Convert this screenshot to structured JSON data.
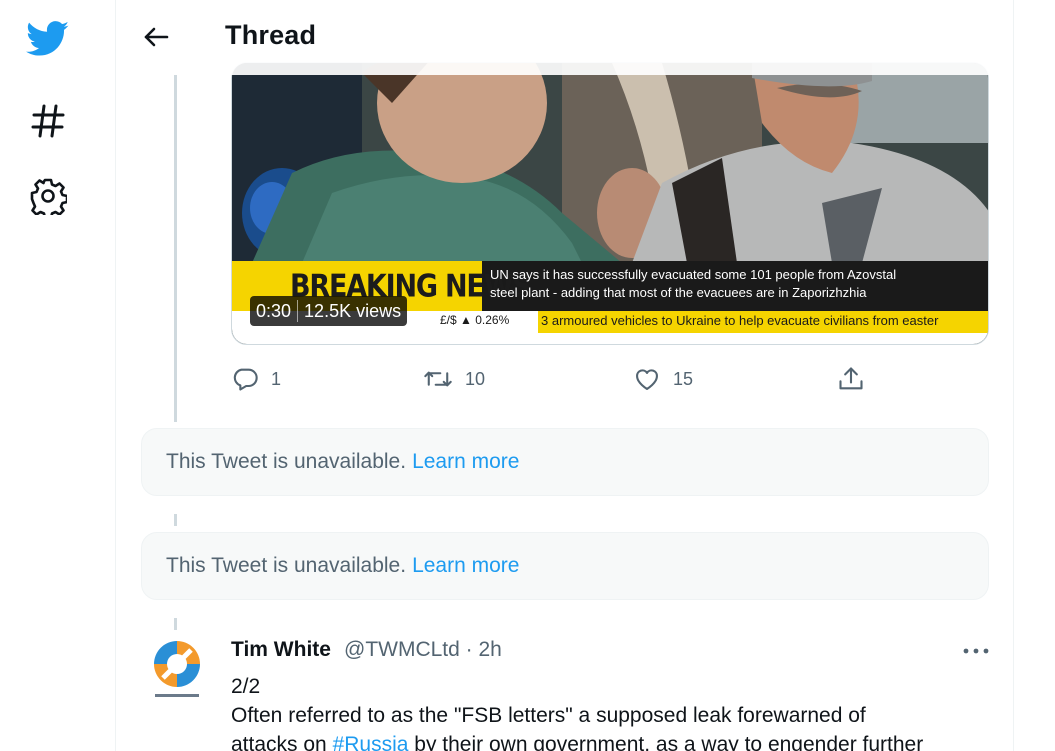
{
  "header": {
    "title": "Thread"
  },
  "nav": {
    "logo_icon": "twitter-bird-icon",
    "explore_icon": "hashtag-icon",
    "settings_icon": "gear-icon"
  },
  "video": {
    "breaking_label": "BREAKING NEWS",
    "caption_line1": "UN says it has successfully evacuated some 101 people from Azovstal",
    "caption_line2": "steel plant - adding that most of the evacuees are in Zaporizhzhia",
    "ticker_rate": "£/$ ▲ 0.26%",
    "ticker_text": "3 armoured vehicles to Ukraine to help evacuate civilians from easter",
    "duration": "0:30",
    "views": "12.5K views"
  },
  "actions": {
    "replies": "1",
    "retweets": "10",
    "likes": "15"
  },
  "unavailable": [
    {
      "text": "This Tweet is unavailable.",
      "link": "Learn more"
    },
    {
      "text": "This Tweet is unavailable.",
      "link": "Learn more"
    }
  ],
  "tweet": {
    "name": "Tim White",
    "handle": "@TWMCLtd",
    "time": "· 2h",
    "line1": "2/2",
    "line2": "Often referred to as the \"FSB letters\" a supposed leak forewarned of",
    "line3_prefix": "attacks on ",
    "hashtag": "#Russia",
    "line3_suffix": " by their own government, as a way to engender further"
  },
  "colors": {
    "brand": "#1d9bf0",
    "muted": "#536471",
    "text": "#0f1419",
    "breaking_yellow": "#f5d400"
  }
}
